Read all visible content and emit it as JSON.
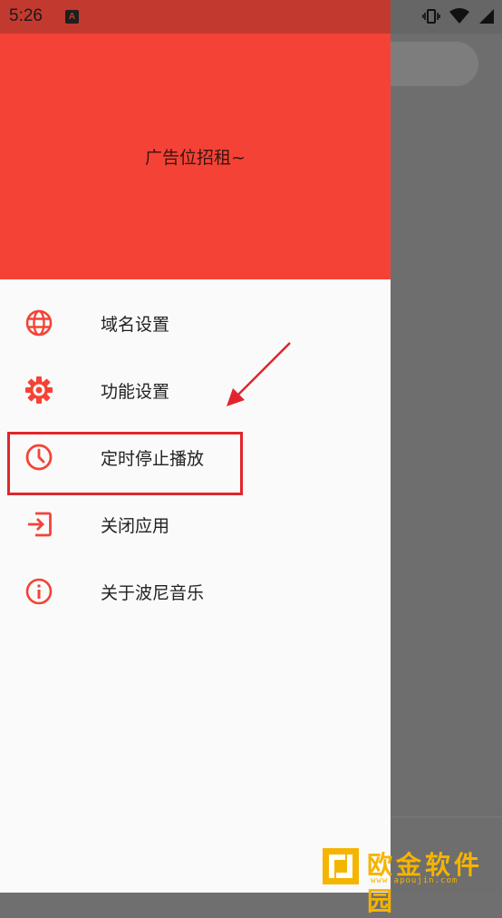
{
  "status_bar": {
    "time": "5:26",
    "notification_badge": "A"
  },
  "drawer": {
    "header_text": "广告位招租~",
    "items": [
      {
        "label": "域名设置",
        "icon": "globe-icon"
      },
      {
        "label": "功能设置",
        "icon": "gear-icon"
      },
      {
        "label": "定时停止播放",
        "icon": "clock-icon"
      },
      {
        "label": "关闭应用",
        "icon": "exit-icon"
      },
      {
        "label": "关于波尼音乐",
        "icon": "info-icon"
      }
    ]
  },
  "watermark": {
    "text": "欧金软件园",
    "url": "www.apoujin.com"
  },
  "colors": {
    "accent": "#f44336",
    "status_bar": "#c23a2f",
    "highlight": "#e0262c",
    "watermark": "#f5b400"
  }
}
